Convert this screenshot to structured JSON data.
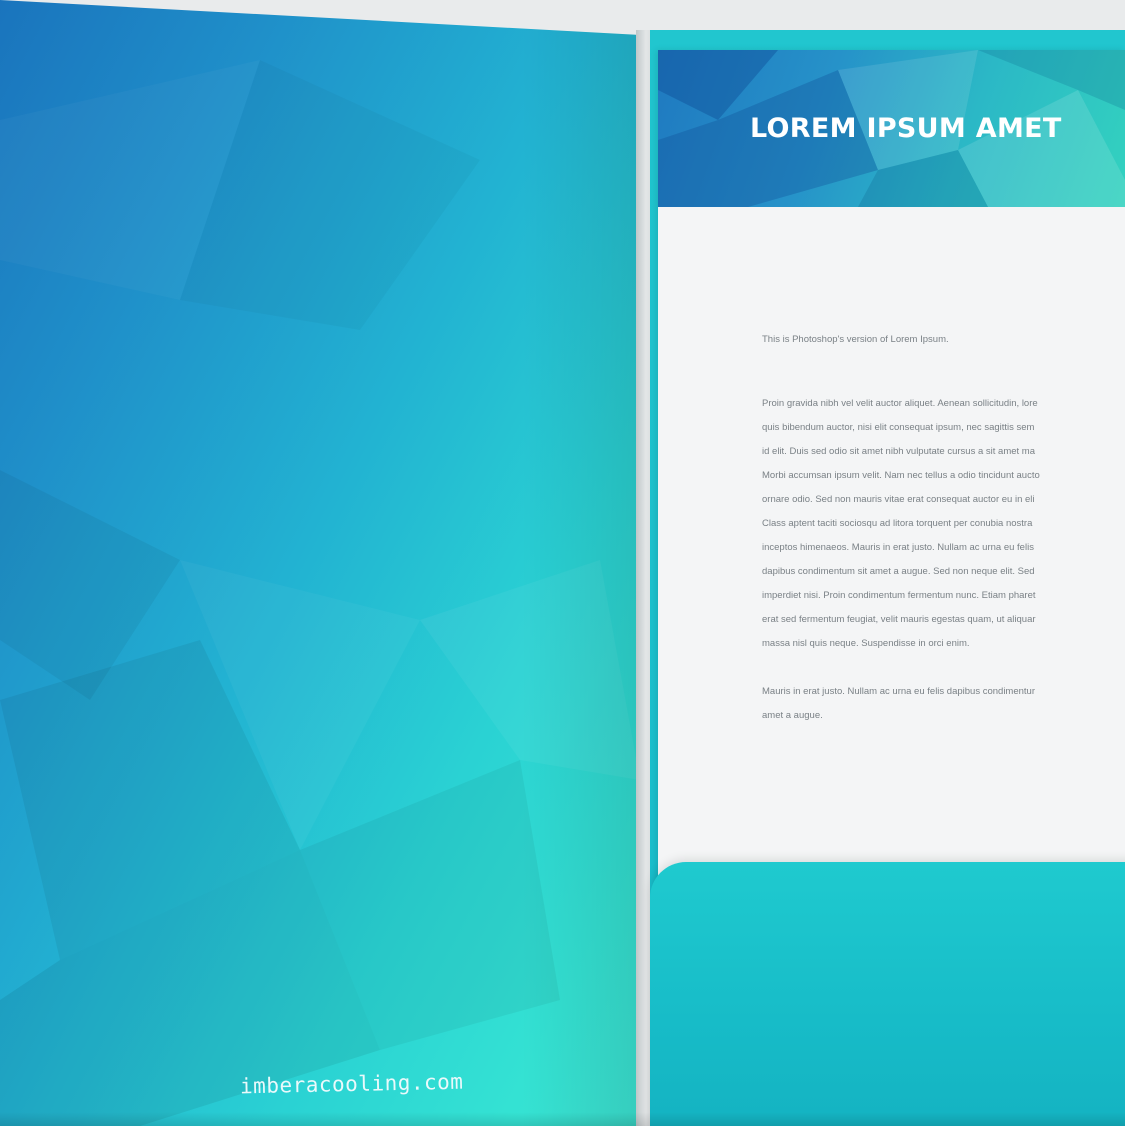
{
  "folder": {
    "website": "imberacooling.com"
  },
  "letter": {
    "title": "LOREM IPSUM AMET",
    "intro": "This is Photoshop's version  of Lorem Ipsum.",
    "paragraph1": [
      "Proin gravida nibh vel velit auctor aliquet. Aenean sollicitudin, lore",
      "quis bibendum auctor, nisi elit consequat ipsum, nec sagittis sem",
      "id elit. Duis sed odio sit amet nibh vulputate cursus a sit amet ma",
      "Morbi accumsan ipsum velit. Nam nec tellus a odio tincidunt aucto",
      "ornare odio. Sed non  mauris vitae erat consequat auctor eu in eli",
      "Class aptent taciti sociosqu ad litora torquent per conubia nostra",
      "inceptos himenaeos. Mauris in erat justo. Nullam ac urna eu felis",
      "dapibus condimentum sit amet a augue. Sed non neque elit. Sed",
      "imperdiet nisi. Proin condimentum fermentum nunc. Etiam pharet",
      "erat sed fermentum feugiat, velit mauris egestas quam, ut aliquar",
      "massa nisl quis neque. Suspendisse in orci enim."
    ],
    "paragraph2": [
      "Mauris in erat justo. Nullam ac urna eu felis dapibus condimentur",
      "amet a augue."
    ]
  },
  "colors": {
    "blue": "#1a74bd",
    "teal": "#3ee7d5",
    "pocket": "#1fcacf",
    "paper": "#f4f5f6"
  }
}
